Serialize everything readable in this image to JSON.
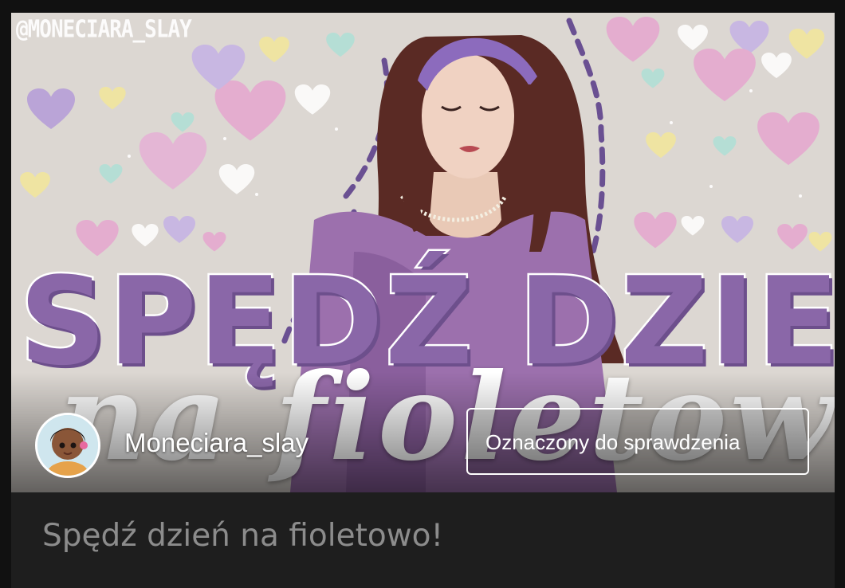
{
  "banner": {
    "watermark": "@MONECIARA_SLAY",
    "headline": "SPĘDŹ DZIEŃ",
    "script_line": "na fioletowo!"
  },
  "author": {
    "name": "Moneciara_slay",
    "avatar_icon": "cartoon-girl-avatar"
  },
  "badge": {
    "label": "Oznaczony do sprawdzenia"
  },
  "post": {
    "title": "Spędź dzień na fioletowo!"
  },
  "colors": {
    "accent_purple": "#8a67a8",
    "background": "#111111",
    "card": "#1e1e1e",
    "title_text": "#8c8c8c"
  }
}
